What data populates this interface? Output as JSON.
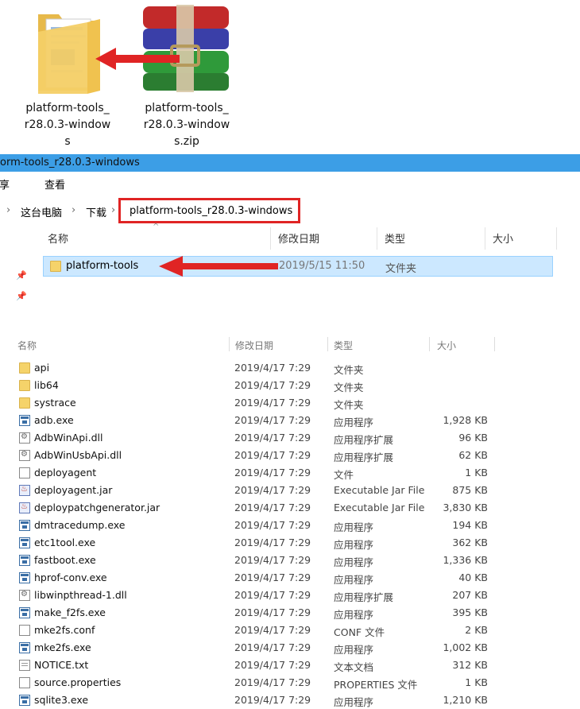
{
  "desktop": {
    "folder_label_lines": [
      "platform-tools_",
      "r28.0.3-window",
      "s"
    ],
    "zip_label_lines": [
      "platform-tools_",
      "r28.0.3-window",
      "s.zip"
    ]
  },
  "window": {
    "title": "orm-tools_r28.0.3-windows",
    "ribbon": {
      "share": "共享",
      "view": "查看"
    },
    "address": {
      "this_pc": "这台电脑",
      "downloads": "下载",
      "current": "platform-tools_r28.0.3-windows"
    },
    "columns": {
      "name": "名称",
      "modified": "修改日期",
      "type": "类型",
      "size": "大小"
    },
    "selected_row": {
      "name": "platform-tools",
      "modified": "2019/5/15 11:50",
      "type": "文件夹"
    }
  },
  "files": [
    {
      "name": "api",
      "modified": "2019/4/17 7:29",
      "type": "文件夹",
      "size": "",
      "icon": "folder-icon"
    },
    {
      "name": "lib64",
      "modified": "2019/4/17 7:29",
      "type": "文件夹",
      "size": "",
      "icon": "folder-icon"
    },
    {
      "name": "systrace",
      "modified": "2019/4/17 7:29",
      "type": "文件夹",
      "size": "",
      "icon": "folder-icon"
    },
    {
      "name": "adb.exe",
      "modified": "2019/4/17 7:29",
      "type": "应用程序",
      "size": "1,928 KB",
      "icon": "exe-icon"
    },
    {
      "name": "AdbWinApi.dll",
      "modified": "2019/4/17 7:29",
      "type": "应用程序扩展",
      "size": "96 KB",
      "icon": "dll-icon"
    },
    {
      "name": "AdbWinUsbApi.dll",
      "modified": "2019/4/17 7:29",
      "type": "应用程序扩展",
      "size": "62 KB",
      "icon": "dll-icon"
    },
    {
      "name": "deployagent",
      "modified": "2019/4/17 7:29",
      "type": "文件",
      "size": "1 KB",
      "icon": "file-icon"
    },
    {
      "name": "deployagent.jar",
      "modified": "2019/4/17 7:29",
      "type": "Executable Jar File",
      "size": "875 KB",
      "icon": "jar-icon"
    },
    {
      "name": "deploypatchgenerator.jar",
      "modified": "2019/4/17 7:29",
      "type": "Executable Jar File",
      "size": "3,830 KB",
      "icon": "jar-icon"
    },
    {
      "name": "dmtracedump.exe",
      "modified": "2019/4/17 7:29",
      "type": "应用程序",
      "size": "194 KB",
      "icon": "exe-icon"
    },
    {
      "name": "etc1tool.exe",
      "modified": "2019/4/17 7:29",
      "type": "应用程序",
      "size": "362 KB",
      "icon": "exe-icon"
    },
    {
      "name": "fastboot.exe",
      "modified": "2019/4/17 7:29",
      "type": "应用程序",
      "size": "1,336 KB",
      "icon": "exe-icon"
    },
    {
      "name": "hprof-conv.exe",
      "modified": "2019/4/17 7:29",
      "type": "应用程序",
      "size": "40 KB",
      "icon": "exe-icon"
    },
    {
      "name": "libwinpthread-1.dll",
      "modified": "2019/4/17 7:29",
      "type": "应用程序扩展",
      "size": "207 KB",
      "icon": "dll-icon"
    },
    {
      "name": "make_f2fs.exe",
      "modified": "2019/4/17 7:29",
      "type": "应用程序",
      "size": "395 KB",
      "icon": "exe-icon"
    },
    {
      "name": "mke2fs.conf",
      "modified": "2019/4/17 7:29",
      "type": "CONF 文件",
      "size": "2 KB",
      "icon": "file-icon"
    },
    {
      "name": "mke2fs.exe",
      "modified": "2019/4/17 7:29",
      "type": "应用程序",
      "size": "1,002 KB",
      "icon": "exe-icon"
    },
    {
      "name": "NOTICE.txt",
      "modified": "2019/4/17 7:29",
      "type": "文本文档",
      "size": "312 KB",
      "icon": "txt-icon"
    },
    {
      "name": "source.properties",
      "modified": "2019/4/17 7:29",
      "type": "PROPERTIES 文件",
      "size": "1 KB",
      "icon": "file-icon"
    },
    {
      "name": "sqlite3.exe",
      "modified": "2019/4/17 7:29",
      "type": "应用程序",
      "size": "1,210 KB",
      "icon": "exe-icon"
    }
  ],
  "colors": {
    "titlebar": "#3c9ee6",
    "selection": "#cce8ff",
    "highlight_box": "#e02424",
    "arrow": "#e02424"
  }
}
